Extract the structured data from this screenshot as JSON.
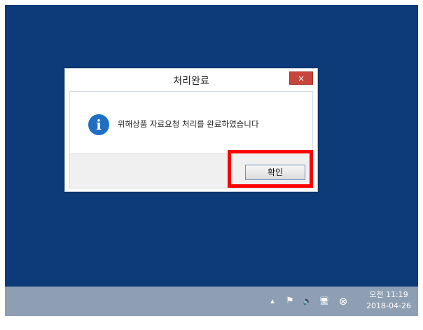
{
  "dialog": {
    "title": "처리완료",
    "close_icon": "×",
    "message": "위해상품 자료요청 처리를 완료하였습니다",
    "info_icon": "i",
    "ok_label": "확인"
  },
  "taskbar": {
    "tray_icons": {
      "chevron": "▴",
      "flag": "⚑",
      "volume": "🔈",
      "network": "🖥",
      "error": "⊗"
    },
    "clock": {
      "time": "오전 11:19",
      "date": "2018-04-26"
    }
  },
  "colors": {
    "desktop": "#0d3a78",
    "close_button": "#c7453a",
    "highlight": "#ff0000",
    "taskbar": "#8e9fb3"
  }
}
